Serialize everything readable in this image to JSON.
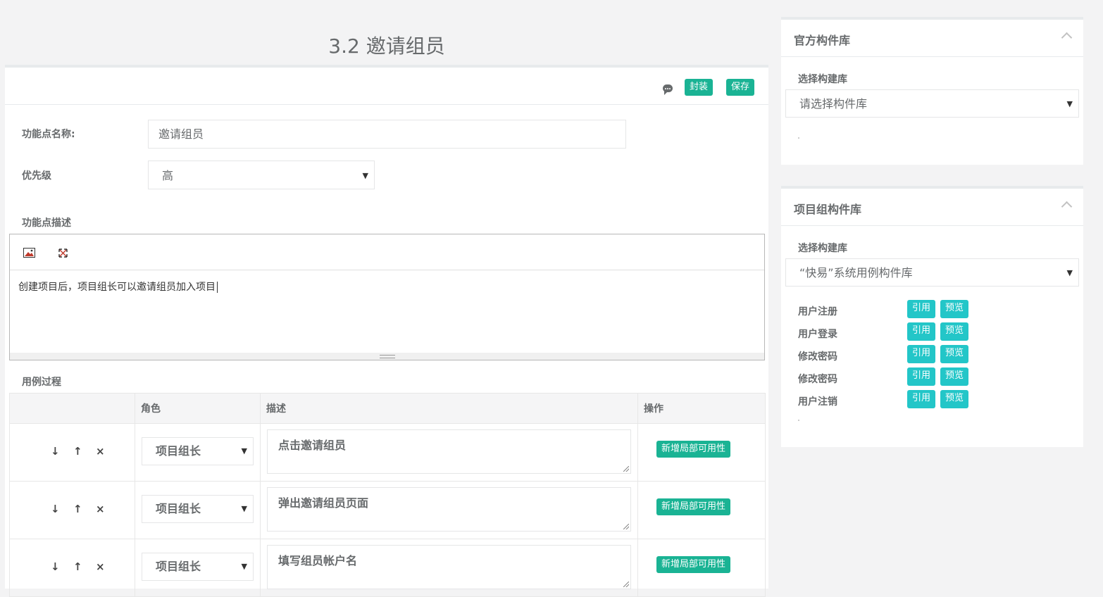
{
  "page": {
    "title": "3.2 邀请组员"
  },
  "toolbar": {
    "encapsulate_label": "封装",
    "save_label": "保存",
    "colors": {
      "primary": "#1ab394",
      "info": "#23c6c8"
    }
  },
  "form": {
    "name_label": "功能点名称:",
    "name_value": "邀请组员",
    "priority_label": "优先级",
    "priority_value": "高",
    "desc_label": "功能点描述",
    "desc_value": "创建项目后，项目组长可以邀请组员加入项目"
  },
  "usecase": {
    "section_label": "用例过程",
    "headers": [
      "",
      "角色",
      "描述",
      "操作"
    ],
    "rows": [
      {
        "role": "项目组长",
        "desc": "点击邀请组员",
        "action": "新增局部可用性"
      },
      {
        "role": "项目组长",
        "desc": "弹出邀请组员页面",
        "action": "新增局部可用性"
      },
      {
        "role": "项目组长",
        "desc": "填写组员帐户名",
        "action": "新增局部可用性"
      }
    ]
  },
  "official_lib": {
    "title": "官方构件库",
    "select_label": "选择构建库",
    "select_value": "请选择构件库"
  },
  "project_lib": {
    "title": "项目组构件库",
    "select_label": "选择构建库",
    "select_value": "“快易”系统用例构件库",
    "cite_label": "引用",
    "preview_label": "预览",
    "items": [
      "用户注册",
      "用户登录",
      "修改密码",
      "修改密码",
      "用户注销"
    ]
  }
}
